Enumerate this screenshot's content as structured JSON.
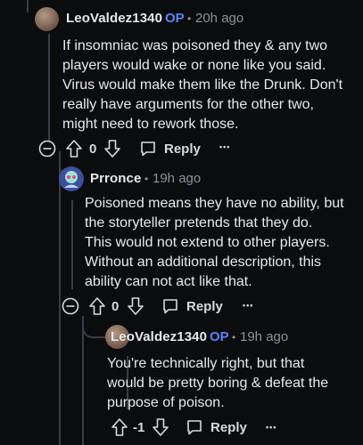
{
  "comments": [
    {
      "author": "LeoValdez1340",
      "op": "OP",
      "dot": "•",
      "time": "20h ago",
      "body": "If insomniac was poisoned they & any two\nplayers would wake or none like you said.\nVirus would make them like the Drunk. Don't\nreally have arguments for the other two,\nmight need to rework those.",
      "votes": "0",
      "reply": "Reply",
      "more": "•••"
    },
    {
      "author": "Prronce",
      "op": "",
      "dot": "•",
      "time": "19h ago",
      "body": "Poisoned means they have no ability, but\nthe storyteller pretends that they do.\nThis would not extend to other players.\nWithout an additional description, this\nability can not act like that.",
      "votes": "0",
      "reply": "Reply",
      "more": "•••"
    },
    {
      "author": "LeoValdez1340",
      "op": "OP",
      "dot": "•",
      "time": "19h ago",
      "body": "You're technically right, but that\nwould be pretty boring & defeat the\npurpose of poison.",
      "votes": "-1",
      "reply": "Reply",
      "more": "•••"
    }
  ],
  "colors": {
    "background": "#0b0c0e",
    "op_accent": "#5a84f5",
    "thread_line": "#3a3d42",
    "text": "#e7e9eb",
    "meta": "#8d9196"
  }
}
